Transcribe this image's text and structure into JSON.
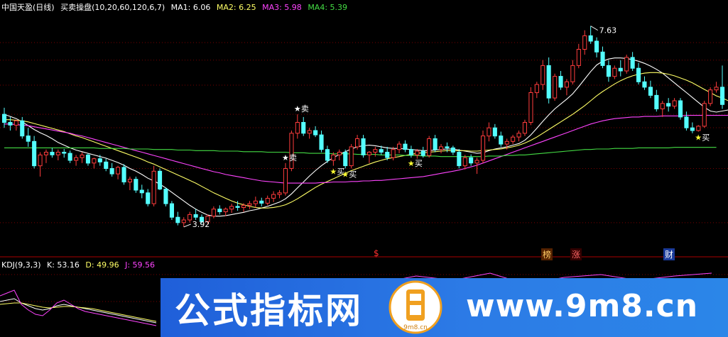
{
  "main_header": {
    "name": "中国天盈(日线)",
    "indicator": "买卖操盘(10,20,60,120,6,7)",
    "ma1": "MA1: 6.06",
    "ma2": "MA2: 6.25",
    "ma3": "MA3: 5.98",
    "ma4": "MA4: 5.39"
  },
  "kdj_header": {
    "name": "KDJ(9,3,3)",
    "k": "K: 53.16",
    "d": "D: 49.96",
    "j": "J: 59.56"
  },
  "colors": {
    "up": "#ff3c3c",
    "down": "#54ffff",
    "ma1": "#ffffff",
    "ma2": "#ffff66",
    "ma3": "#ff44ff",
    "ma4": "#44dd44",
    "grid": "#7a0000"
  },
  "markers": {
    "max_label": "7.63",
    "min_label": "3.92",
    "sell": "卖",
    "buy": "买",
    "tag_s": "$",
    "tag_bang": "榜",
    "tag_zhang": "涨",
    "tag_cai": "财"
  },
  "banner": {
    "title": "公式指标网",
    "url": "www.9m8.cn",
    "logo_text": "9m8.cn"
  },
  "chart_data": {
    "type": "candlestick",
    "title": "中国天盈(日线)",
    "ylim": [
      3.5,
      7.9
    ],
    "candles": [
      [
        6.0,
        6.12,
        5.75,
        5.85
      ],
      [
        5.85,
        5.95,
        5.7,
        5.8
      ],
      [
        5.8,
        5.9,
        5.7,
        5.88
      ],
      [
        5.88,
        5.95,
        5.55,
        5.6
      ],
      [
        5.6,
        5.75,
        5.4,
        5.5
      ],
      [
        5.5,
        5.6,
        5.0,
        5.05
      ],
      [
        5.05,
        5.3,
        4.85,
        5.25
      ],
      [
        5.25,
        5.35,
        5.1,
        5.3
      ],
      [
        5.3,
        5.38,
        5.2,
        5.25
      ],
      [
        5.25,
        5.35,
        5.15,
        5.3
      ],
      [
        5.3,
        5.36,
        5.2,
        5.28
      ],
      [
        5.28,
        5.33,
        5.1,
        5.15
      ],
      [
        5.15,
        5.25,
        5.05,
        5.2
      ],
      [
        5.2,
        5.3,
        5.1,
        5.25
      ],
      [
        5.25,
        5.28,
        5.05,
        5.1
      ],
      [
        5.1,
        5.2,
        5.0,
        5.18
      ],
      [
        5.18,
        5.25,
        5.05,
        5.12
      ],
      [
        5.12,
        5.18,
        4.95,
        5.0
      ],
      [
        5.0,
        5.1,
        4.85,
        4.9
      ],
      [
        4.9,
        5.05,
        4.8,
        5.02
      ],
      [
        5.02,
        5.08,
        4.7,
        4.75
      ],
      [
        4.75,
        4.85,
        4.6,
        4.8
      ],
      [
        4.8,
        4.85,
        4.55,
        4.6
      ],
      [
        4.6,
        4.7,
        4.45,
        4.55
      ],
      [
        4.55,
        4.62,
        4.3,
        4.35
      ],
      [
        4.35,
        5.05,
        4.3,
        4.95
      ],
      [
        4.95,
        5.0,
        4.6,
        4.62
      ],
      [
        4.62,
        4.65,
        4.3,
        4.35
      ],
      [
        4.35,
        4.4,
        4.05,
        4.1
      ],
      [
        4.1,
        4.2,
        3.95,
        4.0
      ],
      [
        4.0,
        4.1,
        3.92,
        4.05
      ],
      [
        4.05,
        4.2,
        4.0,
        4.15
      ],
      [
        4.15,
        4.25,
        4.05,
        4.1
      ],
      [
        4.1,
        4.15,
        3.98,
        4.02
      ],
      [
        4.02,
        4.15,
        3.98,
        4.12
      ],
      [
        4.12,
        4.3,
        4.08,
        4.25
      ],
      [
        4.25,
        4.32,
        4.15,
        4.2
      ],
      [
        4.2,
        4.28,
        4.12,
        4.25
      ],
      [
        4.25,
        4.35,
        4.18,
        4.3
      ],
      [
        4.3,
        4.4,
        4.22,
        4.28
      ],
      [
        4.28,
        4.36,
        4.2,
        4.32
      ],
      [
        4.32,
        4.4,
        4.25,
        4.35
      ],
      [
        4.35,
        4.48,
        4.28,
        4.4
      ],
      [
        4.4,
        4.46,
        4.3,
        4.36
      ],
      [
        4.36,
        4.5,
        4.32,
        4.45
      ],
      [
        4.45,
        4.58,
        4.38,
        4.52
      ],
      [
        4.52,
        4.6,
        4.45,
        4.55
      ],
      [
        4.55,
        5.1,
        4.5,
        5.0
      ],
      [
        5.0,
        5.7,
        4.95,
        5.65
      ],
      [
        5.65,
        6.0,
        5.55,
        5.85
      ],
      [
        5.85,
        5.95,
        5.6,
        5.65
      ],
      [
        5.65,
        5.75,
        5.55,
        5.7
      ],
      [
        5.7,
        5.78,
        5.58,
        5.62
      ],
      [
        5.62,
        5.7,
        5.3,
        5.35
      ],
      [
        5.35,
        5.42,
        5.1,
        5.15
      ],
      [
        5.15,
        5.3,
        5.05,
        5.25
      ],
      [
        5.25,
        5.35,
        5.15,
        5.3
      ],
      [
        5.3,
        5.35,
        5.0,
        5.05
      ],
      [
        5.05,
        5.45,
        5.0,
        5.4
      ],
      [
        5.4,
        5.62,
        5.35,
        5.55
      ],
      [
        5.55,
        5.62,
        5.2,
        5.25
      ],
      [
        5.25,
        5.32,
        5.1,
        5.3
      ],
      [
        5.3,
        5.4,
        5.22,
        5.35
      ],
      [
        5.35,
        5.42,
        5.25,
        5.3
      ],
      [
        5.3,
        5.4,
        5.15,
        5.2
      ],
      [
        5.2,
        5.4,
        5.15,
        5.35
      ],
      [
        5.35,
        5.5,
        5.28,
        5.45
      ],
      [
        5.45,
        5.52,
        5.3,
        5.35
      ],
      [
        5.35,
        5.42,
        5.2,
        5.25
      ],
      [
        5.25,
        5.36,
        5.18,
        5.32
      ],
      [
        5.32,
        5.4,
        5.2,
        5.24
      ],
      [
        5.24,
        5.6,
        5.2,
        5.55
      ],
      [
        5.55,
        5.62,
        5.3,
        5.35
      ],
      [
        5.35,
        5.45,
        5.28,
        5.4
      ],
      [
        5.4,
        5.48,
        5.3,
        5.38
      ],
      [
        5.38,
        5.42,
        5.25,
        5.3
      ],
      [
        5.3,
        5.36,
        5.0,
        5.05
      ],
      [
        5.05,
        5.25,
        4.98,
        5.2
      ],
      [
        5.2,
        5.26,
        5.05,
        5.1
      ],
      [
        5.1,
        5.2,
        4.9,
        5.15
      ],
      [
        5.15,
        5.7,
        5.1,
        5.6
      ],
      [
        5.6,
        5.85,
        5.5,
        5.75
      ],
      [
        5.75,
        5.82,
        5.55,
        5.6
      ],
      [
        5.6,
        5.68,
        5.4,
        5.45
      ],
      [
        5.45,
        5.55,
        5.35,
        5.5
      ],
      [
        5.5,
        5.62,
        5.45,
        5.58
      ],
      [
        5.58,
        5.7,
        5.5,
        5.65
      ],
      [
        5.65,
        5.9,
        5.6,
        5.85
      ],
      [
        5.85,
        6.5,
        5.8,
        6.4
      ],
      [
        6.4,
        6.6,
        6.3,
        6.55
      ],
      [
        6.55,
        7.0,
        6.45,
        6.9
      ],
      [
        6.9,
        7.05,
        6.2,
        6.3
      ],
      [
        6.3,
        6.75,
        6.25,
        6.7
      ],
      [
        6.7,
        6.8,
        6.45,
        6.5
      ],
      [
        6.5,
        6.65,
        6.35,
        6.6
      ],
      [
        6.6,
        7.0,
        6.55,
        6.9
      ],
      [
        6.9,
        7.3,
        6.85,
        7.2
      ],
      [
        7.2,
        7.55,
        7.1,
        7.45
      ],
      [
        7.45,
        7.63,
        7.3,
        7.35
      ],
      [
        7.35,
        7.42,
        7.05,
        7.15
      ],
      [
        7.15,
        7.25,
        6.85,
        6.9
      ],
      [
        6.9,
        7.0,
        6.6,
        6.7
      ],
      [
        6.7,
        6.9,
        6.65,
        6.85
      ],
      [
        6.85,
        7.0,
        6.7,
        6.8
      ],
      [
        6.8,
        7.1,
        6.75,
        7.05
      ],
      [
        7.05,
        7.15,
        6.8,
        6.85
      ],
      [
        6.85,
        6.95,
        6.55,
        6.6
      ],
      [
        6.6,
        6.7,
        6.45,
        6.5
      ],
      [
        6.5,
        6.62,
        6.3,
        6.35
      ],
      [
        6.35,
        6.45,
        6.05,
        6.1
      ],
      [
        6.1,
        6.25,
        5.95,
        6.2
      ],
      [
        6.2,
        6.3,
        6.05,
        6.15
      ],
      [
        6.15,
        6.3,
        6.1,
        6.25
      ],
      [
        6.25,
        6.3,
        5.9,
        5.95
      ],
      [
        5.95,
        6.05,
        5.7,
        5.75
      ],
      [
        5.75,
        5.85,
        5.65,
        5.7
      ],
      [
        5.7,
        5.8,
        5.68,
        5.78
      ],
      [
        5.78,
        6.25,
        5.75,
        6.2
      ],
      [
        6.2,
        6.5,
        6.15,
        6.45
      ],
      [
        6.45,
        6.6,
        6.4,
        6.5
      ],
      [
        6.5,
        6.9,
        6.1,
        6.18
      ]
    ],
    "ma_lines": [
      {
        "name": "MA1",
        "values": [
          6.0,
          5.96,
          5.92,
          5.86,
          5.79,
          5.72,
          5.66,
          5.61,
          5.55,
          5.48,
          5.43,
          5.38,
          5.34,
          5.31,
          5.28,
          5.25,
          5.22,
          5.19,
          5.15,
          5.11,
          5.06,
          5.0,
          4.95,
          4.89,
          4.82,
          4.77,
          4.71,
          4.64,
          4.56,
          4.48,
          4.4,
          4.32,
          4.25,
          4.19,
          4.14,
          4.12,
          4.12,
          4.13,
          4.15,
          4.17,
          4.19,
          4.22,
          4.24,
          4.27,
          4.3,
          4.34,
          4.38,
          4.44,
          4.53,
          4.64,
          4.75,
          4.86,
          4.96,
          5.05,
          5.13,
          5.2,
          5.26,
          5.31,
          5.36,
          5.4,
          5.42,
          5.43,
          5.42,
          5.4,
          5.38,
          5.37,
          5.37,
          5.36,
          5.35,
          5.34,
          5.33,
          5.33,
          5.34,
          5.35,
          5.36,
          5.36,
          5.34,
          5.32,
          5.3,
          5.28,
          5.29,
          5.33,
          5.36,
          5.38,
          5.4,
          5.43,
          5.46,
          5.52,
          5.62,
          5.74,
          5.87,
          5.99,
          6.1,
          6.19,
          6.28,
          6.38,
          6.51,
          6.65,
          6.79,
          6.91,
          6.98,
          7.02,
          7.04,
          7.04,
          7.03,
          7.01,
          6.98,
          6.94,
          6.89,
          6.83,
          6.76,
          6.67,
          6.58,
          6.49,
          6.4,
          6.31,
          6.22,
          6.13,
          6.06,
          6.04,
          6.06,
          6.08
        ]
      },
      {
        "name": "MA2",
        "values": [
          5.9,
          5.9,
          5.89,
          5.88,
          5.86,
          5.83,
          5.8,
          5.77,
          5.74,
          5.71,
          5.68,
          5.64,
          5.6,
          5.57,
          5.53,
          5.49,
          5.45,
          5.41,
          5.37,
          5.33,
          5.29,
          5.25,
          5.21,
          5.17,
          5.12,
          5.08,
          5.03,
          4.98,
          4.93,
          4.88,
          4.83,
          4.78,
          4.73,
          4.67,
          4.61,
          4.55,
          4.5,
          4.45,
          4.4,
          4.36,
          4.33,
          4.3,
          4.28,
          4.27,
          4.27,
          4.28,
          4.3,
          4.33,
          4.38,
          4.44,
          4.51,
          4.58,
          4.65,
          4.71,
          4.76,
          4.81,
          4.86,
          4.91,
          4.96,
          5.0,
          5.04,
          5.08,
          5.12,
          5.15,
          5.18,
          5.2,
          5.22,
          5.24,
          5.26,
          5.28,
          5.29,
          5.3,
          5.31,
          5.32,
          5.33,
          5.33,
          5.33,
          5.33,
          5.32,
          5.32,
          5.33,
          5.34,
          5.35,
          5.36,
          5.38,
          5.4,
          5.43,
          5.47,
          5.52,
          5.58,
          5.65,
          5.72,
          5.79,
          5.86,
          5.93,
          6.0,
          6.08,
          6.16,
          6.25,
          6.34,
          6.42,
          6.49,
          6.56,
          6.62,
          6.67,
          6.71,
          6.74,
          6.76,
          6.77,
          6.77,
          6.76,
          6.74,
          6.71,
          6.67,
          6.63,
          6.58,
          6.52,
          6.46,
          6.4,
          6.34,
          6.3,
          6.25
        ]
      },
      {
        "name": "MA3",
        "values": [
          5.82,
          5.82,
          5.81,
          5.8,
          5.79,
          5.77,
          5.75,
          5.73,
          5.71,
          5.69,
          5.67,
          5.65,
          5.62,
          5.6,
          5.57,
          5.54,
          5.51,
          5.48,
          5.45,
          5.42,
          5.39,
          5.36,
          5.33,
          5.3,
          5.27,
          5.24,
          5.21,
          5.18,
          5.15,
          5.12,
          5.09,
          5.06,
          5.03,
          5.0,
          4.97,
          4.94,
          4.92,
          4.89,
          4.87,
          4.85,
          4.83,
          4.81,
          4.79,
          4.77,
          4.76,
          4.75,
          4.74,
          4.73,
          4.73,
          4.73,
          4.73,
          4.73,
          4.73,
          4.74,
          4.74,
          4.75,
          4.75,
          4.75,
          4.76,
          4.76,
          4.77,
          4.77,
          4.78,
          4.78,
          4.79,
          4.8,
          4.81,
          4.82,
          4.83,
          4.84,
          4.85,
          4.87,
          4.89,
          4.91,
          4.93,
          4.95,
          4.97,
          5.0,
          5.03,
          5.06,
          5.1,
          5.14,
          5.18,
          5.22,
          5.26,
          5.3,
          5.34,
          5.38,
          5.42,
          5.46,
          5.5,
          5.54,
          5.58,
          5.62,
          5.66,
          5.7,
          5.74,
          5.78,
          5.82,
          5.85,
          5.88,
          5.9,
          5.92,
          5.93,
          5.94,
          5.95,
          5.95,
          5.96,
          5.96,
          5.96,
          5.97,
          5.97,
          5.97,
          5.97,
          5.98,
          5.98,
          5.98,
          5.98,
          5.98,
          5.98,
          5.98,
          5.98
        ]
      },
      {
        "name": "MA4",
        "values": [
          5.38,
          5.38,
          5.38,
          5.38,
          5.38,
          5.38,
          5.38,
          5.38,
          5.38,
          5.38,
          5.38,
          5.38,
          5.38,
          5.38,
          5.38,
          5.38,
          5.37,
          5.37,
          5.37,
          5.37,
          5.37,
          5.36,
          5.36,
          5.36,
          5.36,
          5.35,
          5.35,
          5.35,
          5.35,
          5.34,
          5.34,
          5.34,
          5.33,
          5.33,
          5.33,
          5.33,
          5.32,
          5.32,
          5.32,
          5.32,
          5.31,
          5.31,
          5.31,
          5.31,
          5.3,
          5.3,
          5.3,
          5.3,
          5.29,
          5.29,
          5.29,
          5.28,
          5.28,
          5.28,
          5.28,
          5.27,
          5.27,
          5.27,
          5.27,
          5.26,
          5.26,
          5.26,
          5.26,
          5.25,
          5.25,
          5.25,
          5.25,
          5.24,
          5.24,
          5.24,
          5.23,
          5.23,
          5.23,
          5.22,
          5.22,
          5.22,
          5.22,
          5.22,
          5.22,
          5.22,
          5.22,
          5.23,
          5.23,
          5.23,
          5.24,
          5.24,
          5.25,
          5.25,
          5.26,
          5.27,
          5.28,
          5.29,
          5.3,
          5.31,
          5.32,
          5.33,
          5.34,
          5.35,
          5.35,
          5.36,
          5.36,
          5.36,
          5.37,
          5.37,
          5.37,
          5.37,
          5.38,
          5.38,
          5.38,
          5.38,
          5.38,
          5.38,
          5.39,
          5.39,
          5.39,
          5.39,
          5.39,
          5.39,
          5.39,
          5.39
        ]
      }
    ]
  }
}
